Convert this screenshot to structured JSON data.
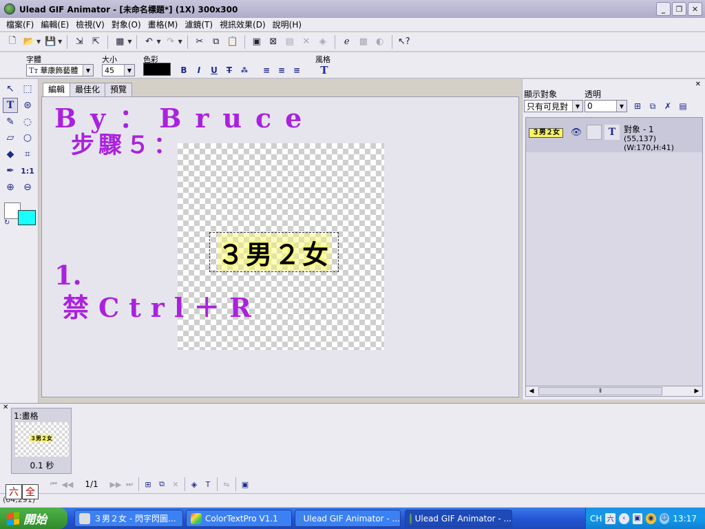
{
  "window": {
    "title": "Ulead GIF Animator - [未命名標題*] (1X) 300x300",
    "buttons": [
      "minimize",
      "restore",
      "close"
    ]
  },
  "menu": [
    "檔案(F)",
    "編輯(E)",
    "檢視(V)",
    "對象(O)",
    "畫格(M)",
    "濾鏡(T)",
    "視訊效果(D)",
    "說明(H)"
  ],
  "toolbar": {
    "icons": [
      "new-icon",
      "open-icon",
      "save-icon",
      "import-icon",
      "export-icon",
      "layer-icon",
      "undo-icon",
      "redo-icon",
      "cut-icon",
      "copy-icon",
      "paste-icon",
      "frame-icon",
      "delete-frame-icon",
      "merge-icon",
      "split-icon",
      "browser-preview-icon",
      "optimize-icon",
      "tween-icon",
      "help-icon"
    ]
  },
  "text_props": {
    "font_label": "字體",
    "font_value": "華康飾藝體",
    "size_label": "大小",
    "size_value": "45",
    "color_label": "色彩",
    "color_value": "#000000",
    "style_label": "風格"
  },
  "tabs": [
    "編輯",
    "最佳化",
    "預覽"
  ],
  "canvas": {
    "object_text": "３男２女",
    "overlay_line1": "By：Bruce",
    "overlay_line2": "步驟５：",
    "overlay_line3": "1.",
    "overlay_line4": "禁Ctrl＋R",
    "overlay_color": "#aa22dd"
  },
  "colors": {
    "foreground": "#ffffff",
    "background": "#19ffff"
  },
  "object_panel": {
    "show_label": "顯示對象",
    "opacity_label": "透明",
    "show_value": "只有可見對",
    "opacity_value": "0",
    "object": {
      "thumb_text": "３男２女",
      "name": "對象 - 1",
      "info": "(55,137)(W:170,H:41)"
    }
  },
  "frame_panel": {
    "frame_label": "1:畫格",
    "frame_delay": "0.1 秒",
    "page_indicator": "1/1"
  },
  "ime": {
    "mode1": "六",
    "mode2": "全"
  },
  "statusbar": {
    "coords": "(64,291)"
  },
  "taskbar": {
    "start": "開始",
    "tasks": [
      "３男２女 - 閃字閃圖...",
      "ColorTextPro V1.1",
      "Ulead GIF Animator - ...",
      "Ulead GIF Animator - ..."
    ],
    "lang": "CH",
    "time": "13:17"
  }
}
